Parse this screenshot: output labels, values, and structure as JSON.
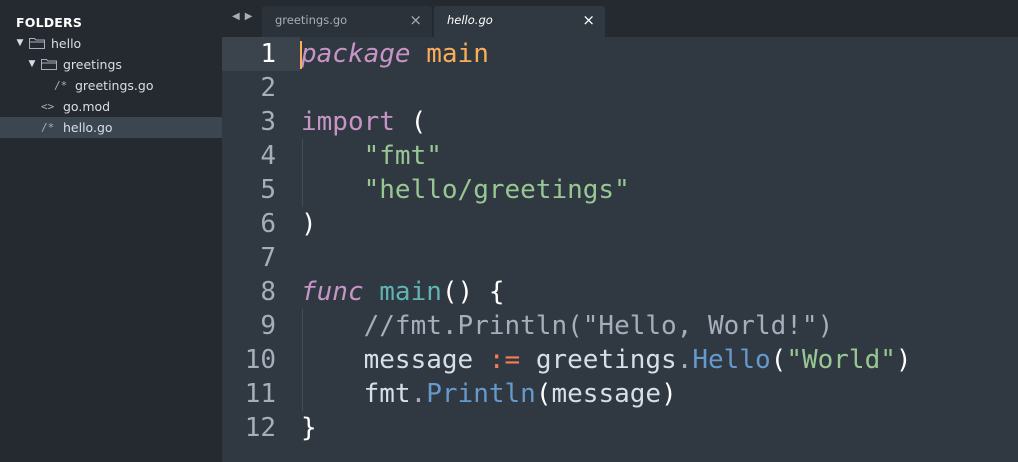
{
  "sidebar": {
    "title": "FOLDERS",
    "items": [
      {
        "label": "hello",
        "type": "folder",
        "expanded": true
      },
      {
        "label": "greetings",
        "type": "folder",
        "expanded": true
      },
      {
        "label": "greetings.go",
        "type": "file",
        "icon": "/*"
      },
      {
        "label": "go.mod",
        "type": "file",
        "icon": "<>"
      },
      {
        "label": "hello.go",
        "type": "file",
        "icon": "/*",
        "selected": true
      }
    ]
  },
  "tabs": [
    {
      "label": "greetings.go",
      "active": false
    },
    {
      "label": "hello.go",
      "active": true
    }
  ],
  "tab_nav": {
    "back": "◀",
    "forward": "▶",
    "close": "×"
  },
  "editor": {
    "current_line": 1,
    "line_numbers": [
      "1",
      "2",
      "3",
      "4",
      "5",
      "6",
      "7",
      "8",
      "9",
      "10",
      "11",
      "12"
    ],
    "lines": [
      [
        {
          "t": "package",
          "c": "kwi"
        },
        {
          "t": " ",
          "c": "txt"
        },
        {
          "t": "main",
          "c": "pkg"
        }
      ],
      [],
      [
        {
          "t": "import",
          "c": "kw"
        },
        {
          "t": " (",
          "c": "pn"
        }
      ],
      [
        {
          "t": "    ",
          "c": "txt"
        },
        {
          "t": "\"fmt\"",
          "c": "str"
        }
      ],
      [
        {
          "t": "    ",
          "c": "txt"
        },
        {
          "t": "\"hello/greetings\"",
          "c": "str"
        }
      ],
      [
        {
          "t": ")",
          "c": "pn"
        }
      ],
      [],
      [
        {
          "t": "func",
          "c": "kwi"
        },
        {
          "t": " ",
          "c": "txt"
        },
        {
          "t": "main",
          "c": "fn"
        },
        {
          "t": "() {",
          "c": "pn"
        }
      ],
      [
        {
          "t": "    ",
          "c": "txt"
        },
        {
          "t": "//fmt.Println(\"Hello, World!\")",
          "c": "cm"
        }
      ],
      [
        {
          "t": "    ",
          "c": "txt"
        },
        {
          "t": "message",
          "c": "txt"
        },
        {
          "t": " ",
          "c": "txt"
        },
        {
          "t": ":=",
          "c": "op"
        },
        {
          "t": " ",
          "c": "txt"
        },
        {
          "t": "greetings",
          "c": "txt"
        },
        {
          "t": ".",
          "c": "cm"
        },
        {
          "t": "Hello",
          "c": "meth"
        },
        {
          "t": "(",
          "c": "pn"
        },
        {
          "t": "\"World\"",
          "c": "str"
        },
        {
          "t": ")",
          "c": "pn"
        }
      ],
      [
        {
          "t": "    ",
          "c": "txt"
        },
        {
          "t": "fmt",
          "c": "txt"
        },
        {
          "t": ".",
          "c": "cm"
        },
        {
          "t": "Println",
          "c": "meth"
        },
        {
          "t": "(",
          "c": "pn"
        },
        {
          "t": "message",
          "c": "txt"
        },
        {
          "t": ")",
          "c": "pn"
        }
      ],
      [
        {
          "t": "}",
          "c": "pn"
        }
      ]
    ]
  },
  "colors": {
    "sidebar_bg": "#252a30",
    "editor_bg": "#303841",
    "selection_bg": "#3c4651",
    "keyword": "#c695c6",
    "string": "#99c794",
    "function": "#5fb4b4",
    "method": "#6699cc",
    "operator": "#f97b58",
    "package_name": "#f9ae58",
    "caret": "#f9ae58"
  }
}
